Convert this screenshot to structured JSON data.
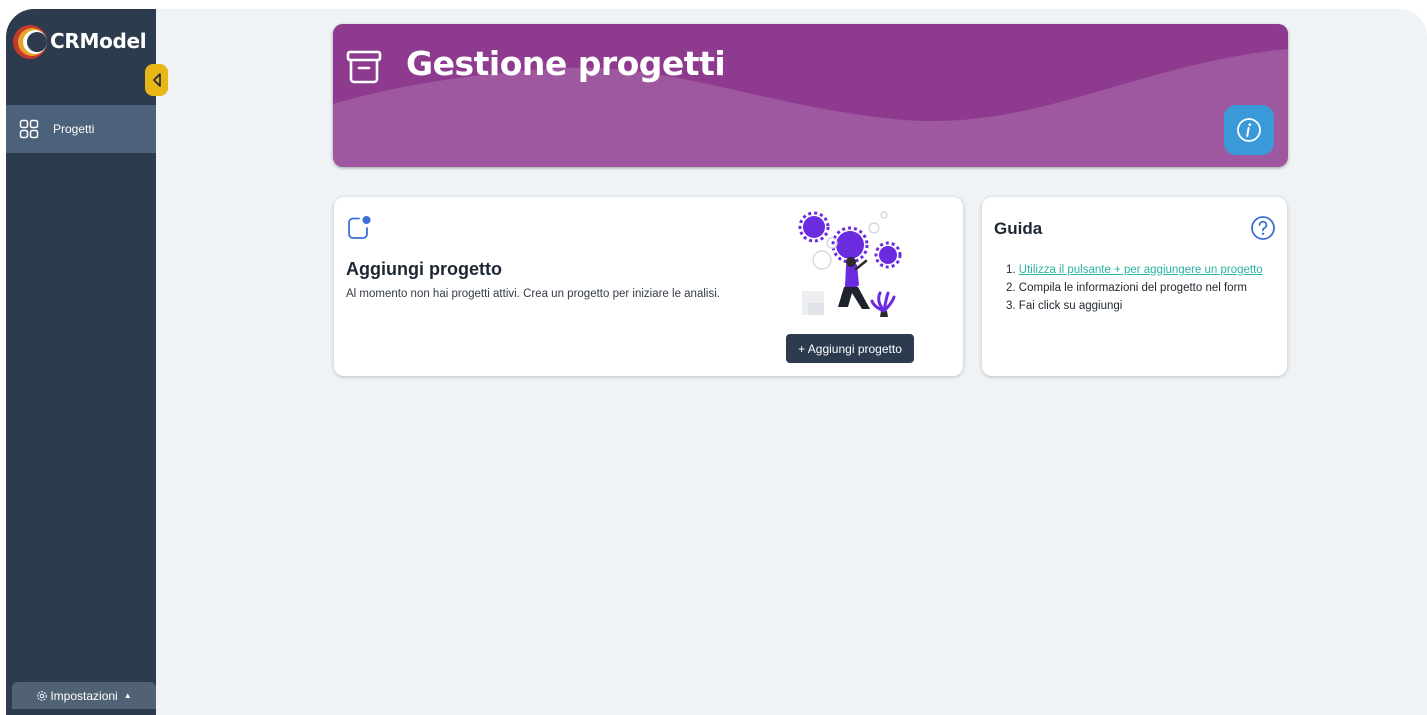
{
  "sidebar": {
    "logo_text": "CRModel",
    "nav_items": [
      {
        "label": "Progetti",
        "icon": "grid-icon"
      }
    ],
    "settings_label": "Impostazioni"
  },
  "banner": {
    "title": "Gestione progetti",
    "icon": "archive-box-icon",
    "info_icon": "info-icon"
  },
  "add_card": {
    "title": "Aggiungi progetto",
    "description": "Al momento non hai progetti attivi. Crea un progetto per iniziare le analisi.",
    "button_label": "+ Aggiungi progetto",
    "icon": "new-item-icon"
  },
  "guide_card": {
    "title": "Guida",
    "steps": [
      {
        "number": "1.",
        "text": "Utilizza il pulsante + per aggiungere un progetto"
      },
      {
        "number": "2.",
        "text": "Compila le informazioni del progetto nel form"
      },
      {
        "number": "3.",
        "text": "Fai click su aggiungi"
      }
    ]
  },
  "colors": {
    "sidebar_bg": "#2c3b4e",
    "sidebar_active": "#4c627a",
    "banner_bg": "#9d589f",
    "banner_wave": "#8e3b8f",
    "info_button": "#3a9ad9",
    "collapse_button": "#e8b716",
    "link": "#2bb3a3",
    "page_bg": "#eff3f5"
  }
}
